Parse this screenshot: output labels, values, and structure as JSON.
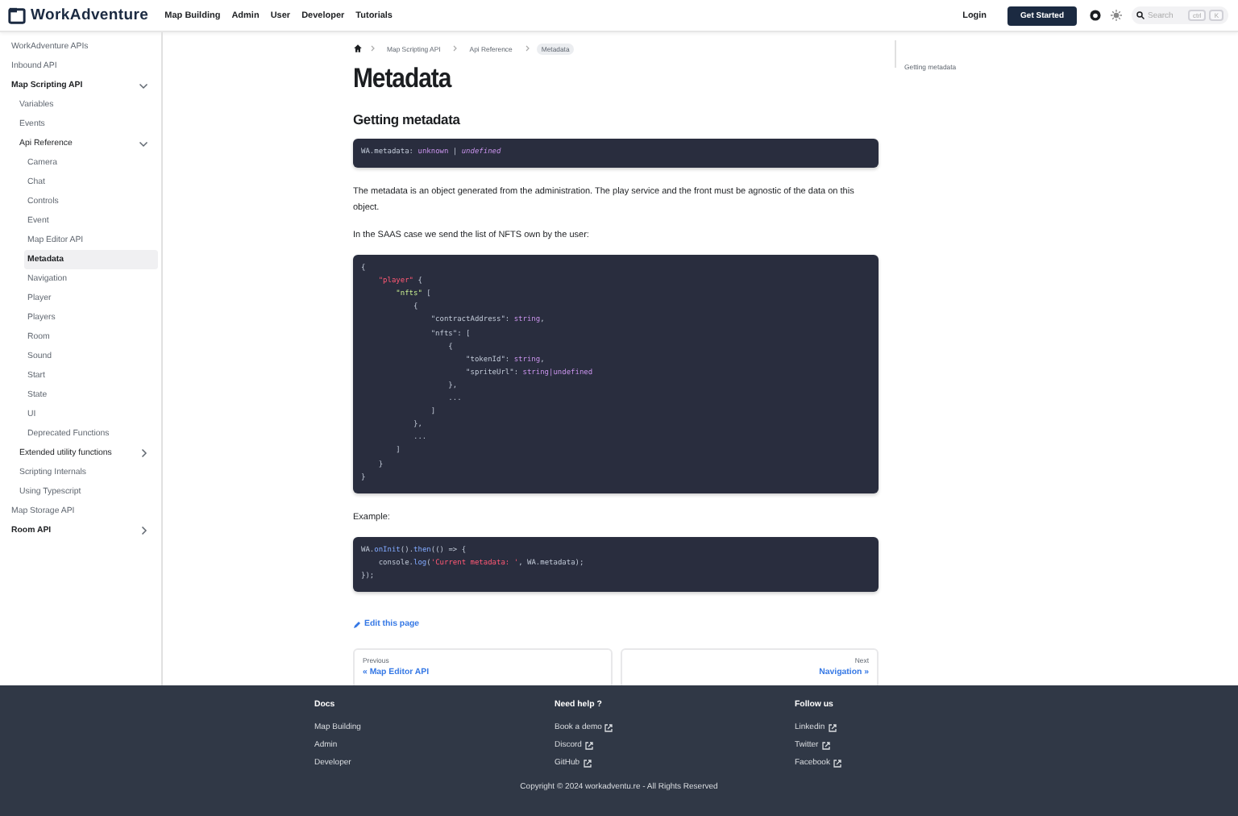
{
  "header": {
    "logo": "WorkAdventure",
    "nav": [
      "Map Building",
      "Admin",
      "User",
      "Developer",
      "Tutorials"
    ],
    "login": "Login",
    "cta": "Get Started",
    "search": {
      "placeholder": "Search",
      "keys": [
        "ctrl",
        "K"
      ]
    }
  },
  "sidebar": {
    "items": [
      {
        "label": "WorkAdventure APIs",
        "selected": false
      },
      {
        "label": "Inbound API",
        "selected": false
      },
      {
        "label": "Map Scripting API",
        "selected": false,
        "expanded": true,
        "children": [
          {
            "label": "Variables",
            "selected": false
          },
          {
            "label": "Events",
            "selected": false
          },
          {
            "label": "Api Reference",
            "selected": false,
            "expanded": true,
            "children": [
              {
                "label": "Camera",
                "selected": false
              },
              {
                "label": "Chat",
                "selected": false
              },
              {
                "label": "Controls",
                "selected": false
              },
              {
                "label": "Event",
                "selected": false
              },
              {
                "label": "Map Editor API",
                "selected": false
              },
              {
                "label": "Metadata",
                "selected": true
              },
              {
                "label": "Navigation",
                "selected": false
              },
              {
                "label": "Player",
                "selected": false
              },
              {
                "label": "Players",
                "selected": false
              },
              {
                "label": "Room",
                "selected": false
              },
              {
                "label": "Sound",
                "selected": false
              },
              {
                "label": "Start",
                "selected": false
              },
              {
                "label": "State",
                "selected": false
              },
              {
                "label": "UI",
                "selected": false
              },
              {
                "label": "Deprecated Functions",
                "selected": false
              }
            ]
          },
          {
            "label": "Extended utility functions",
            "selected": false,
            "expanded": false
          },
          {
            "label": "Scripting Internals",
            "selected": false
          },
          {
            "label": "Using Typescript",
            "selected": false
          }
        ]
      },
      {
        "label": "Map Storage API",
        "selected": false
      },
      {
        "label": "Room API",
        "selected": false,
        "expanded": false
      }
    ]
  },
  "breadcrumbs": [
    {
      "label": "Map Scripting API",
      "selected": false
    },
    {
      "label": "Api Reference",
      "selected": false
    },
    {
      "label": "Metadata",
      "selected": true
    }
  ],
  "title": "Metadata",
  "content": [
    {
      "kind": "heading",
      "text": "Getting metadata"
    },
    {
      "kind": "code",
      "lines": [
        [
          {
            "t": "WA.metadata: ",
            "kind": "plain"
          },
          {
            "t": "unknown",
            "kind": "type"
          },
          {
            "t": " | ",
            "kind": "plain"
          },
          {
            "t": "undefined",
            "kind": "italic"
          }
        ]
      ]
    },
    {
      "kind": "paragraph",
      "text": "The metadata is an object generated from the administration. The play service and the front must be agnostic of the data on this object."
    },
    {
      "kind": "paragraph",
      "text": "In the SAAS case we send the list of NFTS own by the user:"
    },
    {
      "kind": "code",
      "lines": [
        [
          {
            "t": "{",
            "kind": "plain"
          }
        ],
        [
          {
            "t": "    \"player\"",
            "kind": "pink"
          },
          {
            "t": " {",
            "kind": "plain"
          }
        ],
        [
          {
            "t": "        \"nfts\"",
            "kind": "string"
          },
          {
            "t": " [",
            "kind": "plain"
          }
        ],
        [
          {
            "t": "            {",
            "kind": "plain"
          }
        ],
        [
          {
            "t": "                \"contractAddress\": ",
            "kind": "plain"
          },
          {
            "t": "string",
            "kind": "type"
          },
          {
            "t": ",",
            "kind": "plain"
          }
        ],
        [
          {
            "t": "                \"nfts\": [",
            "kind": "plain"
          }
        ],
        [
          {
            "t": "                    {",
            "kind": "plain"
          }
        ],
        [
          {
            "t": "                        \"tokenId\": ",
            "kind": "plain"
          },
          {
            "t": "string",
            "kind": "type"
          },
          {
            "t": ",",
            "kind": "plain"
          }
        ],
        [
          {
            "t": "                        \"spriteUrl\": ",
            "kind": "plain"
          },
          {
            "t": "string|undefined",
            "kind": "type"
          }
        ],
        [
          {
            "t": "                    },",
            "kind": "plain"
          }
        ],
        [
          {
            "t": "                    ...",
            "kind": "plain"
          }
        ],
        [
          {
            "t": "                ]",
            "kind": "plain"
          }
        ],
        [
          {
            "t": "            },",
            "kind": "plain"
          }
        ],
        [
          {
            "t": "            ...",
            "kind": "plain"
          }
        ],
        [
          {
            "t": "        ]",
            "kind": "plain"
          }
        ],
        [
          {
            "t": "    }",
            "kind": "plain"
          }
        ],
        [
          {
            "t": "}",
            "kind": "plain"
          }
        ]
      ]
    },
    {
      "kind": "paragraph",
      "text": "Example:"
    },
    {
      "kind": "code",
      "lines": [
        [
          {
            "t": "WA.",
            "kind": "plain"
          },
          {
            "t": "onInit",
            "kind": "func"
          },
          {
            "t": "().",
            "kind": "plain"
          },
          {
            "t": "then",
            "kind": "func"
          },
          {
            "t": "(() => {",
            "kind": "plain"
          }
        ],
        [
          {
            "t": "    console.",
            "kind": "plain"
          },
          {
            "t": "log",
            "kind": "func"
          },
          {
            "t": "(",
            "kind": "plain"
          },
          {
            "t": "'Current metadata: '",
            "kind": "pink"
          },
          {
            "t": ", WA.metadata);",
            "kind": "plain"
          }
        ],
        [
          {
            "t": "});",
            "kind": "plain"
          }
        ]
      ]
    }
  ],
  "edit_link": "Edit this page",
  "pager": {
    "previous": {
      "caption": "Previous",
      "label": "« Map Editor API"
    },
    "next": {
      "caption": "Next",
      "label": "Navigation »"
    }
  },
  "toc": [
    {
      "label": "Getting metadata"
    }
  ],
  "footer": {
    "columns": [
      {
        "title": "Docs",
        "links": [
          {
            "label": "Map Building",
            "external": false
          },
          {
            "label": "Admin",
            "external": false
          },
          {
            "label": "Developer",
            "external": false
          }
        ]
      },
      {
        "title": "Need help ?",
        "links": [
          {
            "label": "Book a demo",
            "external": true
          },
          {
            "label": "Discord",
            "external": true
          },
          {
            "label": "GitHub",
            "external": true
          }
        ]
      },
      {
        "title": "Follow us",
        "links": [
          {
            "label": "Linkedin",
            "external": true
          },
          {
            "label": "Twitter",
            "external": true
          },
          {
            "label": "Facebook",
            "external": true
          }
        ]
      }
    ],
    "copyright": "Copyright © 2024 workadventu.re - All Rights Reserved"
  }
}
